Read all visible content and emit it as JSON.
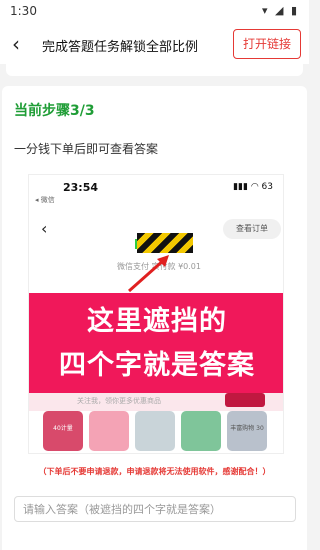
{
  "status_bar": {
    "time": "1:30",
    "icons": "▾ ◢ ▮"
  },
  "appbar": {
    "back_icon": "‹",
    "title": "完成答题任务解锁全部比例",
    "open_link_label": "打开链接"
  },
  "step": {
    "title": "当前步骤3/3",
    "description": "一分钱下单后即可查看答案"
  },
  "embedded_screenshot": {
    "time": "23:54",
    "wechat_label": "◂ 微信",
    "status_icons": "▮▮▮ ◠ 63",
    "back_icon": "‹",
    "order_button_label": "查看订单",
    "pay_text": "微信支付  实付款 ¥0.01",
    "overlay_line1": "这里遮挡的",
    "overlay_line2": "四个字就是答案",
    "follow_text": "关注我，领你更多优惠商品",
    "products": [
      {
        "label": "40计量",
        "color": "#d84a6b"
      },
      {
        "label": "",
        "color": "#f4a3b5"
      },
      {
        "label": "",
        "color": "#c9d4d9"
      },
      {
        "label": "",
        "color": "#7fc59a"
      },
      {
        "label": "",
        "color": "#e1dfe3"
      },
      {
        "label": "丰富购物 30",
        "color": "#b9c1cc"
      }
    ]
  },
  "warning": "（下单后不要申请退款，申请退款将无法使用软件，感谢配合！）",
  "answer_input": {
    "placeholder": "请输入答案（被遮挡的四个字就是答案）",
    "value": ""
  }
}
